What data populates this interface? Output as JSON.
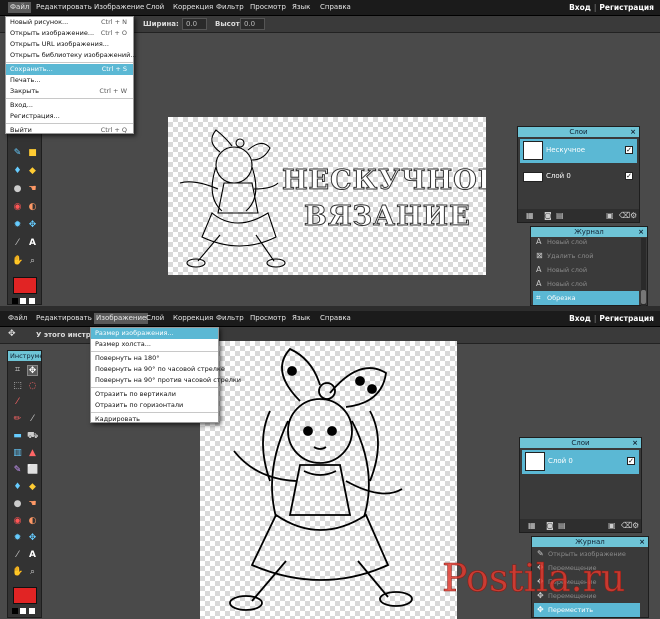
{
  "menu": {
    "file": "Файл",
    "edit": "Редактировать",
    "image": "Изображение",
    "layer": "Слой",
    "correction": "Коррекция",
    "filter": "Фильтр",
    "view": "Просмотр",
    "language": "Язык",
    "help": "Справка"
  },
  "auth": {
    "login": "Вход",
    "separator": "|",
    "register": "Регистрация"
  },
  "shot1": {
    "options": {
      "width_label": "Ширина:",
      "width_value": "0.0",
      "height_label": "Высота:",
      "height_value": "0.0"
    },
    "file_menu": [
      {
        "label": "Новый рисунок...",
        "shortcut": "Ctrl + N"
      },
      {
        "label": "Открыть изображение...",
        "shortcut": "Ctrl + O"
      },
      {
        "label": "Открыть URL изображения...",
        "shortcut": ""
      },
      {
        "label": "Открыть библиотеку изображений...",
        "shortcut": ""
      },
      {
        "label": "Сохранить...",
        "shortcut": "Ctrl + S"
      },
      {
        "label": "Печать...",
        "shortcut": ""
      },
      {
        "label": "Закрыть",
        "shortcut": "Ctrl + W"
      },
      {
        "label": "Вход...",
        "shortcut": ""
      },
      {
        "label": "Регистрация...",
        "shortcut": ""
      },
      {
        "label": "Выйти",
        "shortcut": "Ctrl + Q"
      }
    ],
    "canvas_text_line1": "НЕСКУЧНОЕ",
    "canvas_text_line2": "ВЯЗАНИЕ",
    "layers_panel": {
      "title": "Слои",
      "close": "×",
      "layers": [
        {
          "name": "Нескучное",
          "visible_mark": "✓"
        },
        {
          "name": "Слой 0",
          "visible_mark": "✓"
        }
      ]
    },
    "history_panel": {
      "title": "Журнал",
      "close": "×",
      "items": [
        {
          "label": "Новый слой",
          "icon": "A"
        },
        {
          "label": "Удалить слой",
          "icon": "⊠"
        },
        {
          "label": "Новый слой",
          "icon": "A"
        },
        {
          "label": "Новый слой",
          "icon": "A"
        },
        {
          "label": "Обрезка",
          "icon": "⌗"
        }
      ]
    }
  },
  "shot2": {
    "options": {
      "notice": "У этого инструме"
    },
    "toolbox_title": "Инструмент",
    "image_menu": [
      {
        "label": "Размер изображения..."
      },
      {
        "label": "Размер холста..."
      },
      {
        "label": "Повернуть на 180°"
      },
      {
        "label": "Повернуть на 90° по часовой стрелке"
      },
      {
        "label": "Повернуть на 90° против часовой стрелки"
      },
      {
        "label": "Отразить по вертикали"
      },
      {
        "label": "Отразить по горизонтали"
      },
      {
        "label": "Кадрировать"
      }
    ],
    "layers_panel": {
      "title": "Слои",
      "close": "×",
      "layers": [
        {
          "name": "Слой 0",
          "visible_mark": "✓"
        }
      ]
    },
    "history_panel": {
      "title": "Журнал",
      "close": "×",
      "items": [
        {
          "label": "Открыть изображение",
          "icon": "✎"
        },
        {
          "label": "Перемещение",
          "icon": "✥"
        },
        {
          "label": "Перемещение",
          "icon": "✥"
        },
        {
          "label": "Перемещение",
          "icon": "✥"
        },
        {
          "label": "Переместить",
          "icon": "✥"
        }
      ]
    }
  },
  "watermark": {
    "text": "Postila.ru"
  },
  "colors": {
    "accent": "#5bb8d4",
    "panel_header": "#6ec4d6",
    "primary_swatch": "#e12424",
    "watermark": "#e03a2f"
  }
}
